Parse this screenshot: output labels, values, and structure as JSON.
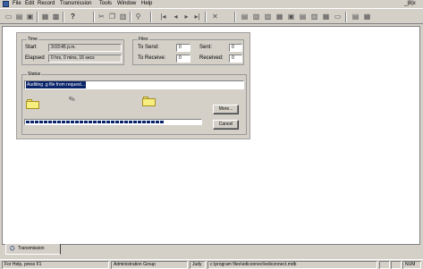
{
  "menu": {
    "items": [
      "File",
      "Edit",
      "Record",
      "Transmission",
      "Tools",
      "Window",
      "Help"
    ],
    "window_controls": "_|8|x"
  },
  "toolbar": {
    "icons": [
      "new-icon",
      "open-icon",
      "save-icon",
      "view-icon",
      "view2-icon",
      "help-icon",
      "cut-icon",
      "copy-icon",
      "paste-icon",
      "find-icon",
      "first-icon",
      "prev-icon",
      "next-icon",
      "last-icon",
      "delete-icon",
      "tool1-icon",
      "tool2-icon",
      "tool3-icon",
      "tool4-icon",
      "tool5-icon",
      "tool6-icon",
      "tool7-icon",
      "tool8-icon",
      "tool9-icon",
      "tool10-icon"
    ]
  },
  "time": {
    "title": "Time",
    "start_label": "Start",
    "start_value": "3:03:45 p.m.",
    "elapsed_label": "Elapsed",
    "elapsed_value": "0 hrs, 0 mins, 16 secs"
  },
  "files": {
    "title": "Files",
    "to_send_label": "To Send:",
    "to_send_value": "0",
    "sent_label": "Sent:",
    "sent_value": "0",
    "to_receive_label": "To Receive:",
    "to_receive_value": "0",
    "received_label": "Received:",
    "received_value": "0"
  },
  "status": {
    "title": "Status",
    "text": "Auditing .g file from request..."
  },
  "buttons": {
    "more": "More...",
    "cancel": "Cancel"
  },
  "progress": {
    "fraction": 0.8
  },
  "tab": {
    "label": "Transmission"
  },
  "statusbar": {
    "help": "For Help, press F1",
    "group": "Administration Group",
    "user": "Judy",
    "path": "c:\\program files\\ediconnect\\ediconnect.mdb",
    "ind1": "",
    "ind2": "",
    "num": "NUM"
  }
}
